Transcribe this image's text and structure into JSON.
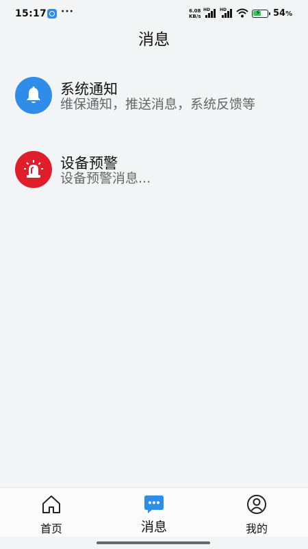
{
  "status_bar": {
    "time": "15:17",
    "more": "···",
    "net_speed_value": "6.08",
    "net_speed_unit": "KB/s",
    "sim1_label": "HD",
    "sim2_label": "HD",
    "battery_percent": "54",
    "battery_unit": "%"
  },
  "header": {
    "title": "消息"
  },
  "messages": [
    {
      "title": "系统通知",
      "subtitle": "维保通知，推送消息，系统反馈等",
      "icon": "bell-icon",
      "color": "#2d8de8"
    },
    {
      "title": "设备预警",
      "subtitle": "设备预警消息...",
      "icon": "alarm-light-icon",
      "color": "#e01d2a"
    }
  ],
  "tab_bar": {
    "items": [
      {
        "label": "首页",
        "icon": "home-icon",
        "active": false
      },
      {
        "label": "消息",
        "icon": "chat-bubble-icon",
        "active": true
      },
      {
        "label": "我的",
        "icon": "user-icon",
        "active": false
      }
    ],
    "active_color": "#2d8de8"
  }
}
